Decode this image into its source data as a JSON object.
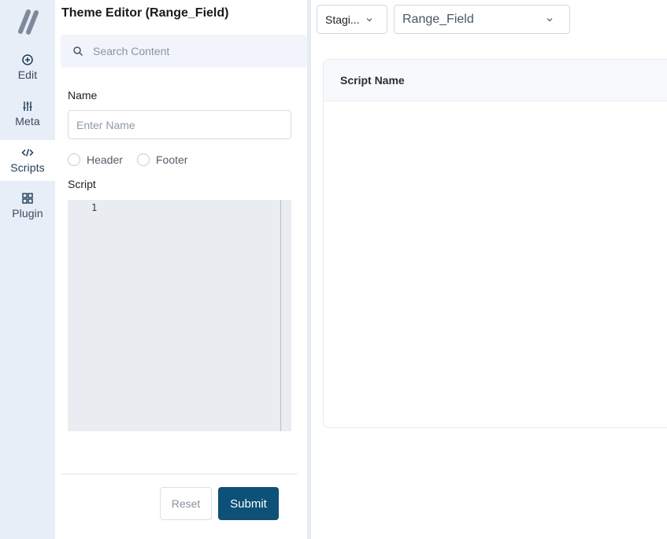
{
  "rail": {
    "items": [
      {
        "id": "edit",
        "label": "Edit",
        "icon": "plus-circle-icon"
      },
      {
        "id": "meta",
        "label": "Meta",
        "icon": "sliders-icon"
      },
      {
        "id": "scripts",
        "label": "Scripts",
        "icon": "code-icon"
      },
      {
        "id": "plugin",
        "label": "Plugin",
        "icon": "grid-icon"
      }
    ],
    "active": "scripts"
  },
  "panel": {
    "title": "Theme Editor  (Range_Field)",
    "search_placeholder": "Search Content",
    "name_label": "Name",
    "name_placeholder": "Enter Name",
    "radio_header": "Header",
    "radio_footer": "Footer",
    "script_label": "Script",
    "line_number": "1",
    "reset_label": "Reset",
    "submit_label": "Submit"
  },
  "toolbar": {
    "environment": "Stagi...",
    "theme": "Range_Field"
  },
  "table": {
    "header": "Script Name"
  },
  "colors": {
    "rail_bg": "#e8eef7",
    "accent": "#0d5078"
  }
}
